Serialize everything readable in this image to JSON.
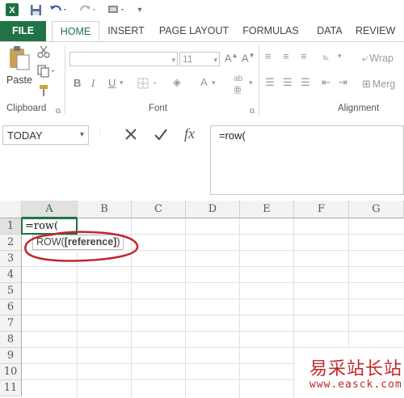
{
  "colors": {
    "accent": "#217346",
    "ribbon_text": "#444444",
    "annotation": "#c0272d"
  },
  "quick_access": {
    "app_icon": "excel-icon",
    "save_icon": "save-icon",
    "undo_icon": "undo-icon",
    "redo_icon": "redo-icon",
    "customize_icon": "customize-icon"
  },
  "tabs": [
    {
      "label": "FILE"
    },
    {
      "label": "HOME"
    },
    {
      "label": "INSERT"
    },
    {
      "label": "PAGE LAYOUT"
    },
    {
      "label": "FORMULAS"
    },
    {
      "label": "DATA"
    },
    {
      "label": "REVIEW"
    }
  ],
  "ribbon": {
    "clipboard": {
      "paste_label": "Paste",
      "group_label": "Clipboard"
    },
    "font": {
      "font_size": "11",
      "group_label": "Font"
    },
    "alignment": {
      "wrap_label": "Wrap",
      "merge_label": "Merg",
      "group_label": "Alignment"
    }
  },
  "name_box": {
    "value": "TODAY"
  },
  "formula_bar": {
    "value": "=row(",
    "cancel_icon": "cancel-icon",
    "enter_icon": "check-icon",
    "fx_label": "fx"
  },
  "sheet": {
    "columns": [
      "A",
      "B",
      "C",
      "D",
      "E",
      "F",
      "G"
    ],
    "rows": [
      "1",
      "2",
      "3",
      "4",
      "5",
      "6",
      "7",
      "8",
      "9",
      "10",
      "11"
    ],
    "active_cell_text": "=row(",
    "tooltip": {
      "prefix": "ROW(",
      "arg": "[reference]",
      "suffix": ")"
    }
  },
  "watermark": {
    "text_cn": "易采站长站",
    "url": "www.easck.com"
  }
}
